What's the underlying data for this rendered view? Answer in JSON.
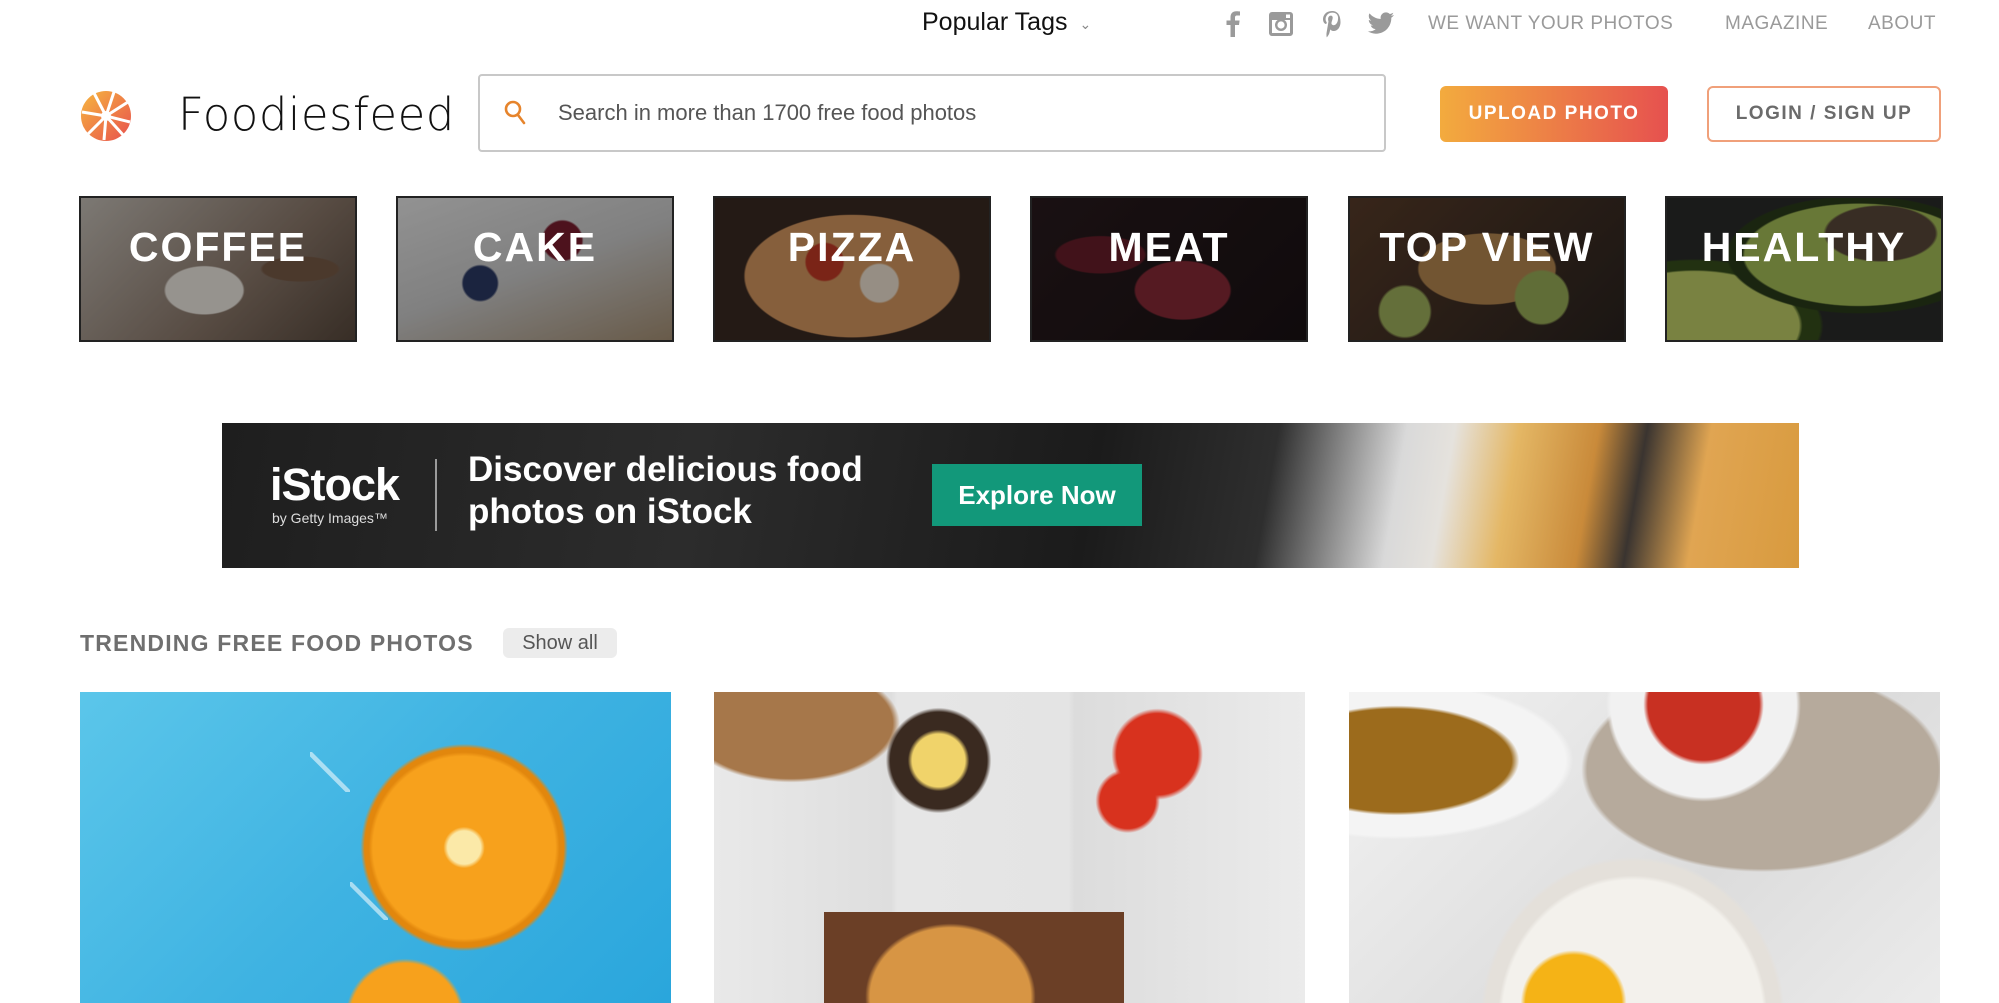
{
  "topnav": {
    "popular_tags": "Popular Tags",
    "social": [
      {
        "name": "facebook-icon"
      },
      {
        "name": "instagram-icon"
      },
      {
        "name": "pinterest-icon"
      },
      {
        "name": "twitter-icon"
      }
    ],
    "links": [
      "WE WANT YOUR PHOTOS",
      "MAGAZINE",
      "ABOUT"
    ]
  },
  "header": {
    "logo_text": "Foodiesfeed",
    "search_placeholder": "Search in more than 1700 free food photos",
    "search_value": "",
    "upload_label": "UPLOAD PHOTO",
    "login_label": "LOGIN / SIGN UP",
    "accent_start": "#f3ab3e",
    "accent_end": "#e6514f"
  },
  "categories": [
    {
      "label": "COFFEE"
    },
    {
      "label": "CAKE"
    },
    {
      "label": "PIZZA"
    },
    {
      "label": "MEAT"
    },
    {
      "label": "TOP VIEW"
    },
    {
      "label": "HEALTHY"
    }
  ],
  "ad": {
    "brand": "iStock",
    "brand_sub": "by Getty Images™",
    "headline_line1": "Discover delicious food",
    "headline_line2": "photos on iStock",
    "cta": "Explore Now",
    "cta_color": "#12987a"
  },
  "trending": {
    "title": "TRENDING FREE FOOD PHOTOS",
    "show_all": "Show all",
    "photos": [
      {
        "alt": "Orange slice and ice cubes on blue background"
      },
      {
        "alt": "Burger with iced drink, tomatoes and pepper mill on wooden table"
      },
      {
        "alt": "Avocado toast with fried egg, tea and tomatoes"
      }
    ]
  }
}
